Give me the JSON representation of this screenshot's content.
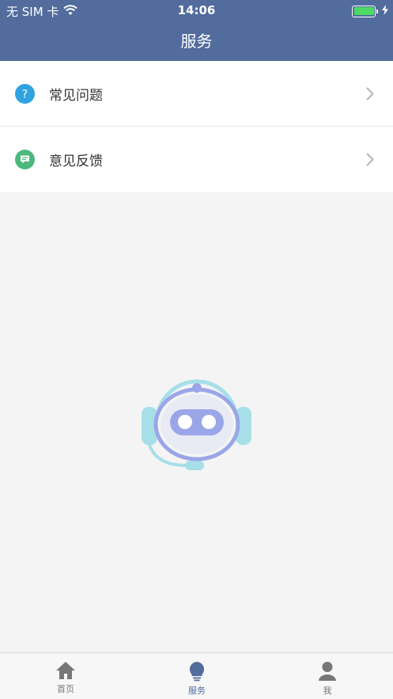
{
  "status_bar": {
    "carrier": "无 SIM 卡",
    "time": "14:06",
    "battery_percent": 100
  },
  "header": {
    "title": "服务"
  },
  "menu": {
    "items": [
      {
        "label": "常见问题",
        "icon": "question-circle-icon",
        "icon_color": "#2fa3df"
      },
      {
        "label": "意见反馈",
        "icon": "message-circle-icon",
        "icon_color": "#4cb87c"
      }
    ]
  },
  "illustration": {
    "icon": "robot-headset-icon"
  },
  "tabbar": {
    "tabs": [
      {
        "label": "首页",
        "icon": "home-icon",
        "active": false
      },
      {
        "label": "服务",
        "icon": "lightbulb-icon",
        "active": true
      },
      {
        "label": "我",
        "icon": "user-icon",
        "active": false
      }
    ]
  },
  "colors": {
    "primary": "#516c9d",
    "background": "#f4f4f4",
    "tab_inactive": "#777777"
  }
}
